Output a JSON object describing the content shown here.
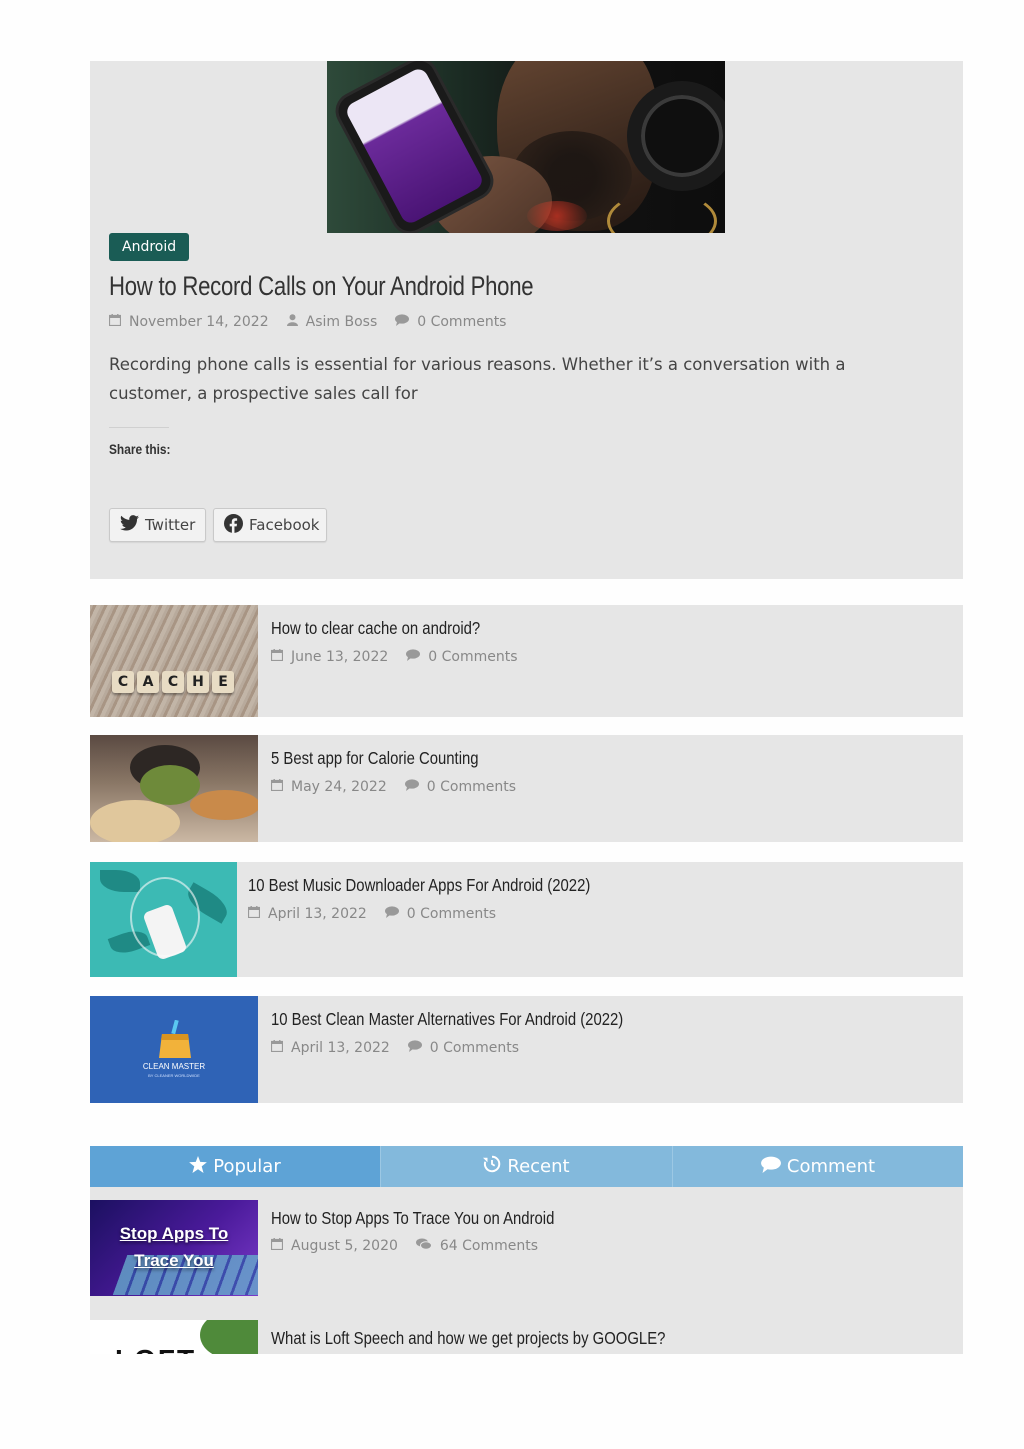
{
  "featured": {
    "category": "Android",
    "title": "How to Record Calls on Your Android Phone",
    "date": "November 14, 2022",
    "author": "Asim Boss",
    "comments": "0 Comments",
    "excerpt": "Recording phone calls is essential for various reasons. Whether it’s a conversation with a customer, a prospective sales call for",
    "share_label": "Share this:",
    "share_twitter": "Twitter",
    "share_facebook": "Facebook"
  },
  "posts": [
    {
      "title": "How to clear cache on android?",
      "date": "June 13, 2022",
      "comments": "0 Comments",
      "thumb_text": "CACHE"
    },
    {
      "title": "5 Best app for Calorie Counting",
      "date": "May 24, 2022",
      "comments": "0 Comments"
    },
    {
      "title": "10 Best Music Downloader Apps For Android (2022)",
      "date": "April 13, 2022",
      "comments": "0 Comments"
    },
    {
      "title": "10 Best Clean Master Alternatives For Android (2022)",
      "date": "April 13, 2022",
      "comments": "0 Comments",
      "thumb_text": "CLEAN MASTER",
      "thumb_subtext": "BY CLEANER WORLDWIDE"
    }
  ],
  "tabs": [
    {
      "label": "Popular",
      "icon": "star-icon",
      "active": true
    },
    {
      "label": "Recent",
      "icon": "history-icon",
      "active": false
    },
    {
      "label": "Comment",
      "icon": "comment-icon",
      "active": false
    }
  ],
  "popular": [
    {
      "title": "How to Stop Apps To Trace You on Android",
      "date": "August 5, 2020",
      "comments": "64 Comments",
      "thumb_text": "Stop Apps To Trace You"
    },
    {
      "title": "What is Loft Speech and how we get projects by GOOGLE?",
      "thumb_text": "LOFT"
    }
  ],
  "colors": {
    "badge": "#1a5c55",
    "tab_active": "#5ea3d6",
    "tab_inactive": "#83b9dc",
    "card_bg": "#e6e6e6"
  }
}
